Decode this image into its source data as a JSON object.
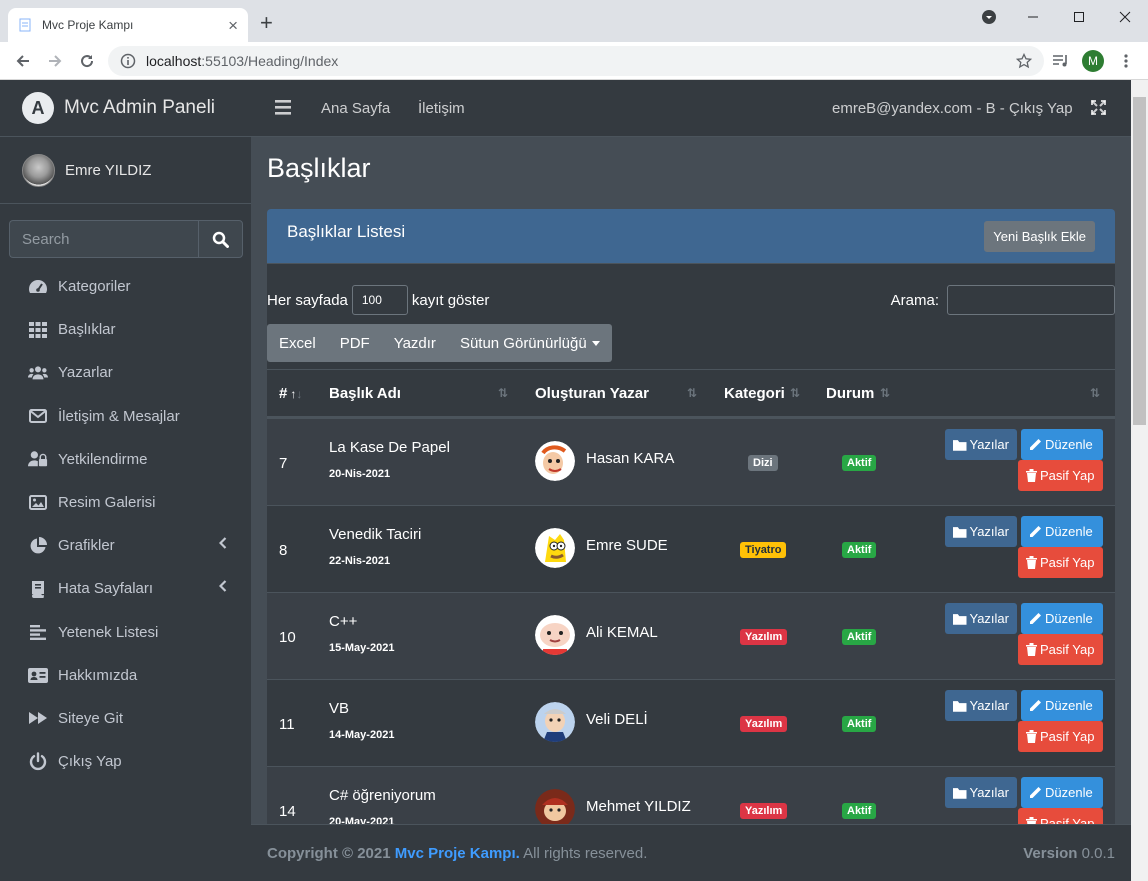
{
  "browser": {
    "tab_title": "Mvc Proje Kampı",
    "url_host": "localhost",
    "url_path": ":55103/Heading/Index",
    "profile_initial": "M"
  },
  "sidebar": {
    "brand": "Mvc Admin Paneli",
    "user_name": "Emre YILDIZ",
    "search_placeholder": "Search",
    "items": [
      {
        "label": "Kategoriler",
        "icon": "tachometer-icon"
      },
      {
        "label": "Başlıklar",
        "icon": "grid-icon"
      },
      {
        "label": "Yazarlar",
        "icon": "users-icon"
      },
      {
        "label": "İletişim & Mesajlar",
        "icon": "envelope-icon"
      },
      {
        "label": "Yetkilendirme",
        "icon": "user-lock-icon"
      },
      {
        "label": "Resim Galerisi",
        "icon": "image-icon"
      },
      {
        "label": "Grafikler",
        "icon": "pie-chart-icon"
      },
      {
        "label": "Hata Sayfaları",
        "icon": "book-icon"
      },
      {
        "label": "Yetenek Listesi",
        "icon": "align-left-icon"
      },
      {
        "label": "Hakkımızda",
        "icon": "id-card-icon"
      },
      {
        "label": "Siteye Git",
        "icon": "forward-icon"
      },
      {
        "label": "Çıkış Yap",
        "icon": "power-icon"
      }
    ]
  },
  "topbar": {
    "home": "Ana Sayfa",
    "contact": "İletişim",
    "account": "emreB@yandex.com - B - Çıkış Yap"
  },
  "page": {
    "title": "Başlıklar",
    "card_title": "Başlıklar Listesi",
    "new_button": "Yeni Başlık Ekle",
    "length_prefix": "Her sayfada",
    "length_value": "100",
    "length_suffix": "kayıt göster",
    "search_label": "Arama:",
    "export_buttons": [
      "Excel",
      "PDF",
      "Yazdır",
      "Sütun Görünürlüğü"
    ]
  },
  "table": {
    "columns": [
      "#",
      "Başlık Adı",
      "Oluşturan Yazar",
      "Kategori",
      "Durum"
    ],
    "btn_yazilar": "Yazılar",
    "btn_duzenle": "Düzenle",
    "btn_pasif": "Pasif Yap",
    "rows": [
      {
        "id": "7",
        "title": "La Kase De Papel",
        "date": "20-Nis-2021",
        "author": "Hasan KARA",
        "category": "Dizi",
        "status": "Aktif"
      },
      {
        "id": "8",
        "title": "Venedik Taciri",
        "date": "22-Nis-2021",
        "author": "Emre SUDE",
        "category": "Tiyatro",
        "status": "Aktif"
      },
      {
        "id": "10",
        "title": "C++",
        "date": "15-May-2021",
        "author": "Ali KEMAL",
        "category": "Yazılım",
        "status": "Aktif"
      },
      {
        "id": "11",
        "title": "VB",
        "date": "14-May-2021",
        "author": "Veli DELİ",
        "category": "Yazılım",
        "status": "Aktif"
      },
      {
        "id": "14",
        "title": "C# öğreniyorum",
        "date": "20-May-2021",
        "author": "Mehmet YILDIZ",
        "category": "Yazılım",
        "status": "Aktif"
      }
    ]
  },
  "footer": {
    "copyright": "Copyright © 2021",
    "brand_link": "Mvc Proje Kampı.",
    "rights": "All rights reserved.",
    "version_label": "Version",
    "version_value": "0.0.1"
  },
  "colors": {
    "sidebar_bg": "#343a40",
    "content_bg": "#454d55",
    "card_header": "#3f6791",
    "success": "#28a745",
    "danger": "#dc3545",
    "warning": "#ffc107",
    "link": "#3f9cff"
  }
}
